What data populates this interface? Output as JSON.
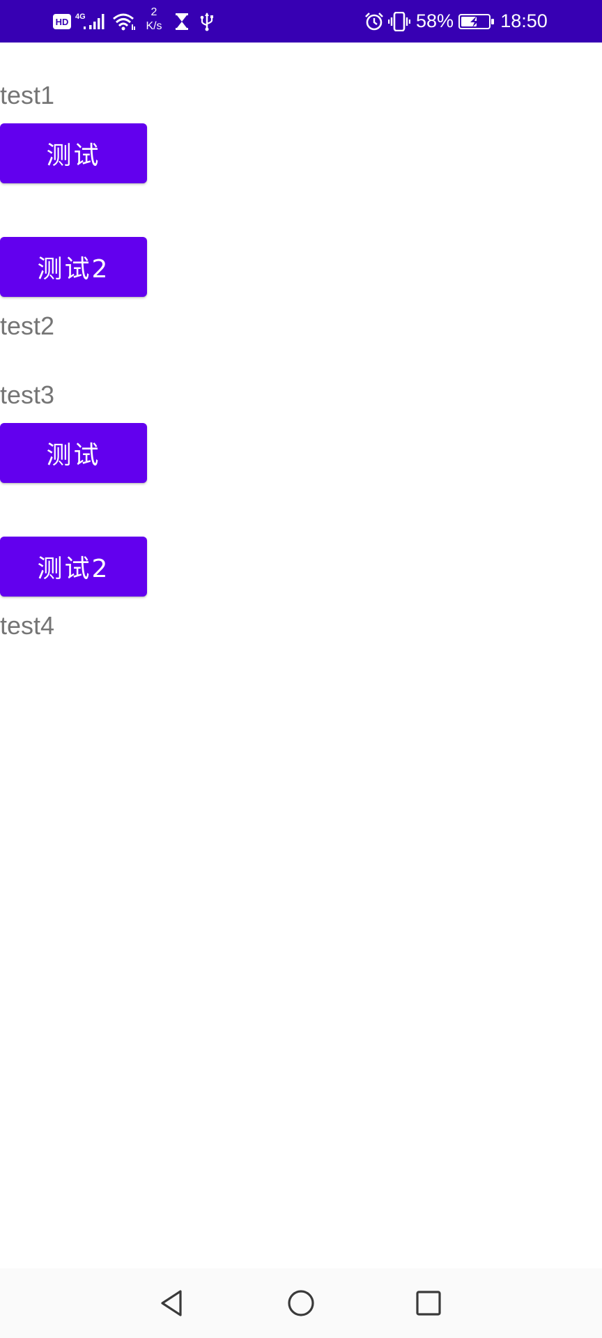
{
  "status_bar": {
    "hd_badge": "HD",
    "network": "4G",
    "speed_value": "2",
    "speed_unit": "K/s",
    "battery_percent": "58%",
    "battery_level": 0.58,
    "time": "18:50",
    "icons": [
      "hd-icon",
      "signal-icon",
      "wifi-icon",
      "hourglass-icon",
      "usb-icon",
      "alarm-icon",
      "vibrate-icon",
      "battery-icon"
    ],
    "background_color": "#3700b3"
  },
  "content": {
    "label_1": "test1",
    "button_1": "测试",
    "button_2": "测试2",
    "label_2": "test2",
    "label_3": "test3",
    "button_3": "测试",
    "button_4": "测试2",
    "label_4": "test4",
    "button_color": "#6200ee",
    "label_color": "#757575"
  },
  "nav_bar": {
    "icons": [
      "back-icon",
      "home-icon",
      "recents-icon"
    ]
  }
}
